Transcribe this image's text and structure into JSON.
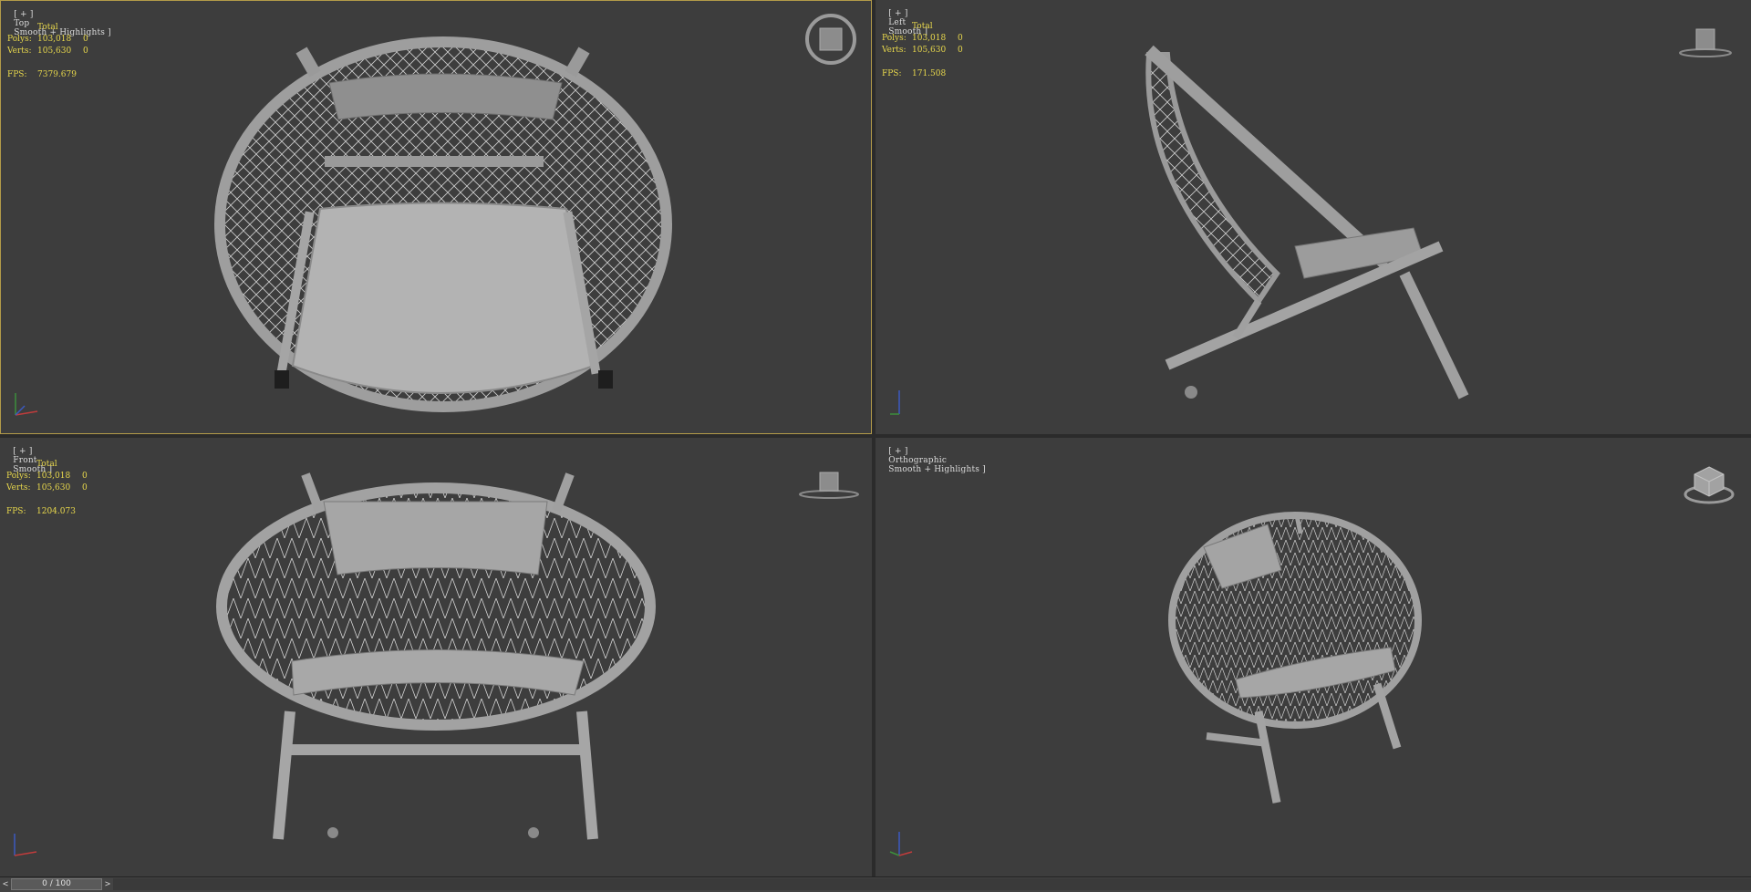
{
  "viewports": [
    {
      "id": "top",
      "label_plus": "[ + ]",
      "view": "Top",
      "shading": "Smooth + Highlights ]",
      "stats": {
        "total": "Total",
        "polys_label": "Polys:",
        "polys_value": "103,018",
        "polys_sel": "0",
        "verts_label": "Verts:",
        "verts_value": "105,630",
        "verts_sel": "0",
        "fps_label": "FPS:",
        "fps_value": "7379.679"
      },
      "active": true
    },
    {
      "id": "left",
      "label_plus": "[ + ]",
      "view": "Left",
      "shading": "Smooth ]",
      "stats": {
        "total": "Total",
        "polys_label": "Polys:",
        "polys_value": "103,018",
        "polys_sel": "0",
        "verts_label": "Verts:",
        "verts_value": "105,630",
        "verts_sel": "0",
        "fps_label": "FPS:",
        "fps_value": "171.508"
      },
      "active": false
    },
    {
      "id": "front",
      "label_plus": "[ + ]",
      "view": "Front",
      "shading": "Smooth ]",
      "stats": {
        "total": "Total",
        "polys_label": "Polys:",
        "polys_value": "103,018",
        "polys_sel": "0",
        "verts_label": "Verts:",
        "verts_value": "105,630",
        "verts_sel": "0",
        "fps_label": "FPS:",
        "fps_value": "1204.073"
      },
      "active": false
    },
    {
      "id": "persp",
      "label_plus": "[ + ]",
      "view": "Orthographic",
      "shading": "Smooth + Highlights ]",
      "stats": null,
      "active": false
    }
  ],
  "timeline": {
    "frame": "0 / 100",
    "prev": "<",
    "next": ">"
  },
  "colors": {
    "viewport_bg": "#3d3d3d",
    "active_border": "#b39b49",
    "stats_text": "#e8d84c",
    "model": "#a9a9a9"
  },
  "icons": [
    "viewcube-icon",
    "axis-tripod-icon"
  ]
}
